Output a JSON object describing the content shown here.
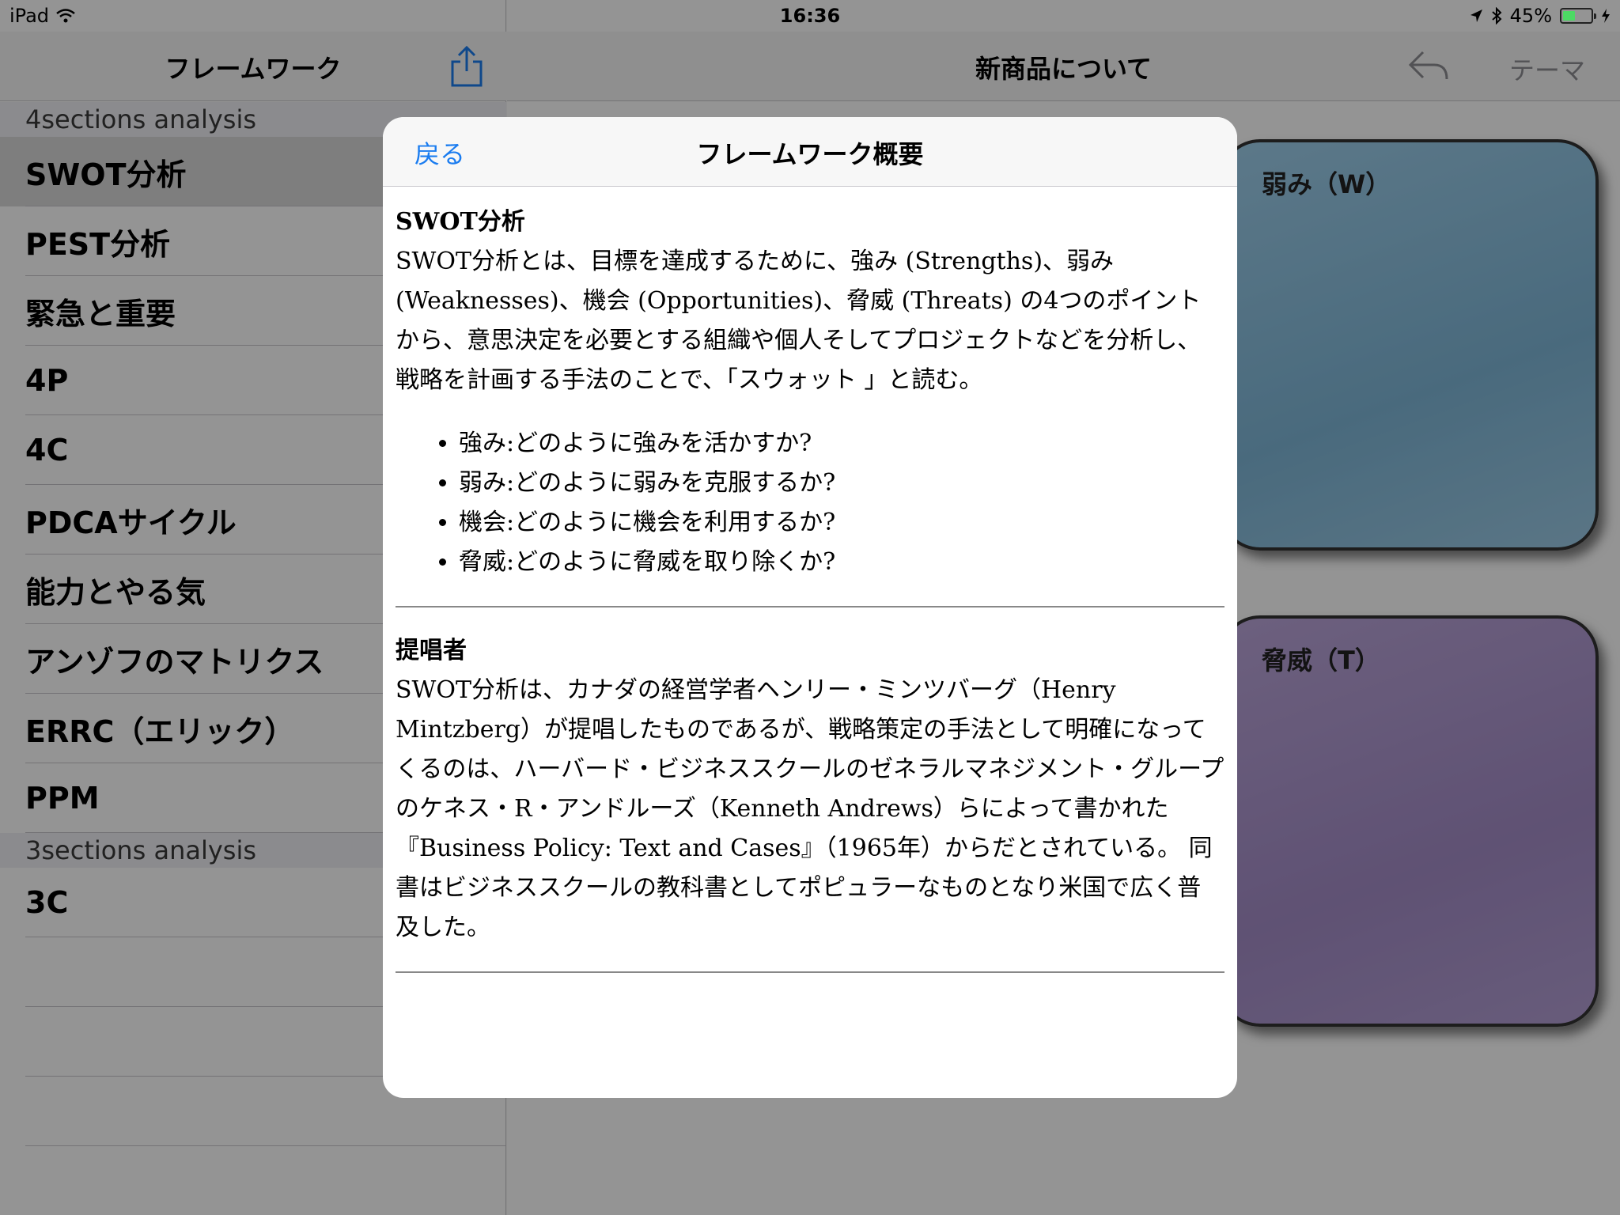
{
  "status": {
    "device": "iPad",
    "time": "16:36",
    "battery": "45%",
    "battery_level": 0.45
  },
  "master": {
    "title": "フレームワーク",
    "sections": [
      {
        "header": "4sections analysis",
        "items": [
          "SWOT分析",
          "PEST分析",
          "緊急と重要",
          "4P",
          "4C",
          "PDCAサイクル",
          "能力とやる気",
          "アンゾフのマトリクス",
          "ERRC（エリック）",
          "PPM"
        ]
      },
      {
        "header": "3sections analysis",
        "items": [
          "3C"
        ]
      }
    ],
    "selected_item": "SWOT分析"
  },
  "detail": {
    "title": "新商品について",
    "theme_label": "テーマ",
    "cards": {
      "weakness": "弱み（W）",
      "threat": "脅威（T）"
    }
  },
  "modal": {
    "back_label": "戻る",
    "title": "フレームワーク概要",
    "section1_heading": "SWOT分析",
    "section1_text": "SWOT分析とは、目標を達成するために、強み (Strengths)、弱み (Weaknesses)、機会 (Opportunities)、脅威 (Threats) の4つのポイントから、意思決定を必要とする組織や個人そしてプロジェクトなどを分析し、戦略を計画する手法のことで、「スウォット 」と読む。",
    "bullets": [
      "強み:どのように強みを活かすか?",
      "弱み:どのように弱みを克服するか?",
      "機会:どのように機会を利用するか?",
      "脅威:どのように脅威を取り除くか?"
    ],
    "section2_heading": "提唱者",
    "section2_text": "SWOT分析は、カナダの経営学者ヘンリー・ミンツバーグ（Henry Mintzberg）が提唱したものであるが、戦略策定の手法として明確になってくるのは、ハーバード・ビジネススクールのゼネラルマネジメント・グループのケネス・R・アンドルーズ（Kenneth Andrews）らによって書かれた『Business Policy: Text and Cases』（1965年）からだとされている。 同書はビジネススクールの教科書としてポピュラーなものとなり米国で広く普及した。"
  }
}
